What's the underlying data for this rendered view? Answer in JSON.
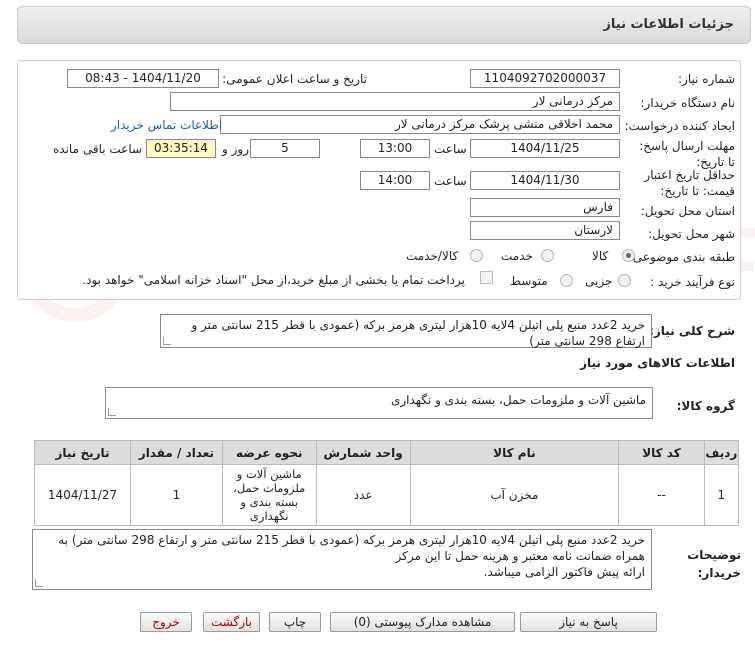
{
  "header": {
    "title": "جزئیات اطلاعات نیاز"
  },
  "form": {
    "need_number_label": "شماره نیاز:",
    "need_number": "1104092702000037",
    "announce_label": "تاریخ و ساعت اعلان عمومی:",
    "announce_value": "1404/11/20 - 08:43",
    "buyer_org_label": "نام دستگاه خریدار:",
    "buyer_org": "مرکز درمانی لار",
    "requester_label": "ایجاد کننده درخواست:",
    "requester": "محمد  اخلاقی منشی پزشک مرکز درمانی لار",
    "contact_link": "اطلاعات تماس خریدار",
    "reply_deadline_label": "مهلت ارسال پاسخ: تا تاریخ:",
    "reply_date": "1404/11/25",
    "time_label": "ساعت",
    "reply_time": "13:00",
    "days_value": "5",
    "days_label": "روز و",
    "remaining_time": "03:35:14",
    "remaining_label": "ساعت باقی مانده",
    "validity_label": "حداقل تاریخ اعتبار قیمت: تا تاریخ:",
    "validity_date": "1404/11/30",
    "validity_time": "14:00",
    "province_label": "استان محل تحویل:",
    "province": "فارس",
    "city_label": "شهر محل تحویل:",
    "city": "لارستان",
    "category_label": "طبقه بندی موضوعی:",
    "category_options": [
      "کالا",
      "خدمت",
      "کالا/خدمت"
    ],
    "purchase_type_label": "نوع فرآیند خرید :",
    "purchase_options": [
      "جزیی",
      "متوسط"
    ],
    "payment_note": "پرداخت تمام یا بخشی از مبلغ خرید،از محل \"اسناد خزانه اسلامی\" خواهد بود."
  },
  "summary": {
    "label": "شرح کلی نیاز:",
    "text": "خرید 2عدد منبع پلی اتیلن 4لایه 10هزار لیتری هرمز برکه (عمودی با قطر 215 سانتی متر و ارتفاع 298 سانتی متر)"
  },
  "goods": {
    "section_title": "اطلاعات کالاهای مورد نیاز",
    "group_label": "گروه کالا:",
    "group_value": "ماشین آلات و ملزومات حمل، بسته بندی و نگهداری"
  },
  "table": {
    "headers": [
      "ردیف",
      "کد کالا",
      "نام کالا",
      "واحد شمارش",
      "نحوه عرضه",
      "تعداد / مقدار",
      "تاریخ نیاز"
    ],
    "rows": [
      [
        "1",
        "--",
        "مخزن آب",
        "عدد",
        "ماشین آلات و ملزومات حمل، بسته بندی و نگهداری",
        "1",
        "1404/11/27"
      ]
    ]
  },
  "buyer_notes": {
    "label": "توضیحات خریدار:",
    "text": "خرید 2عدد منبع پلی اتیلن 4لایه 10هزار لیتری هرمز برکه (عمودی با قطر 215 سانتی متر و ارتفاع 298 سانتی متر) به همراه ضمانت نامه معتبر و هزینه حمل تا این مرکز\nارائه پیش فاکتور الزامی میباشد."
  },
  "buttons": {
    "reply": "پاسخ به نیاز",
    "attachments": "مشاهده مدارک پیوستی (0)",
    "print": "چاپ",
    "back": "بازگشت",
    "exit": "خروج"
  },
  "watermark": "AriaTender.net"
}
